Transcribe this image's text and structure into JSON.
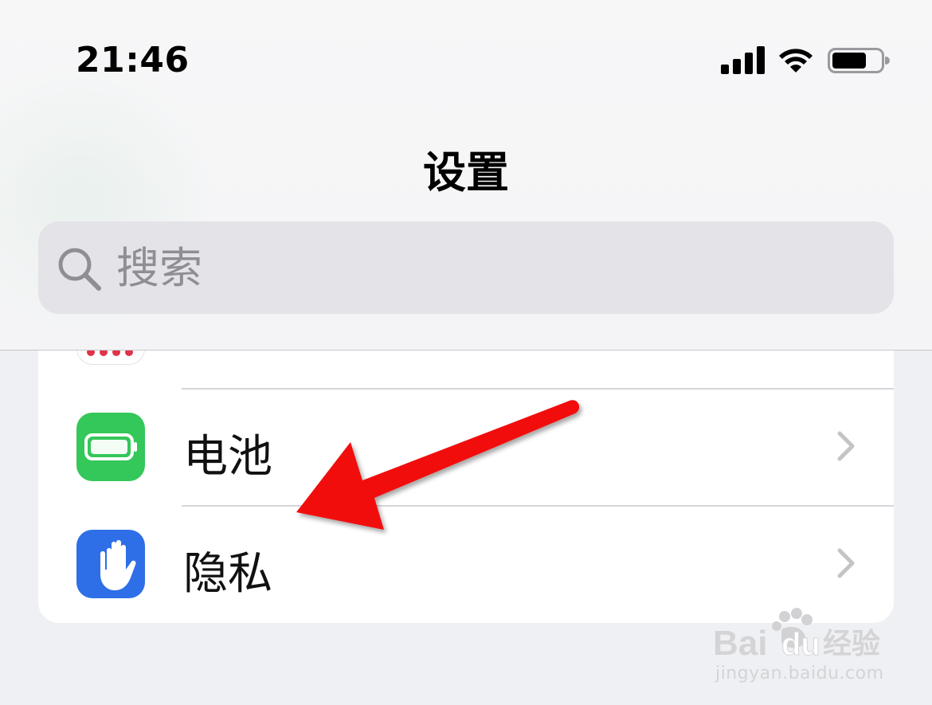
{
  "status_bar": {
    "time": "21:46",
    "icons": [
      "cellular-signal-icon",
      "wifi-icon",
      "battery-icon"
    ]
  },
  "header": {
    "title": "设置"
  },
  "search": {
    "placeholder": "搜索",
    "icon": "search-icon"
  },
  "list": {
    "items": [
      {
        "label": "电池",
        "icon": "battery-app-icon",
        "icon_color": "#34C759"
      },
      {
        "label": "隐私",
        "icon": "privacy-hand-icon",
        "icon_color": "#2E6FE8"
      }
    ]
  },
  "annotation": {
    "type": "red-arrow-icon",
    "color": "#F21010",
    "points_to": "隐私"
  },
  "watermark": {
    "brand": "Baidu经验",
    "domain": "jingyan.baidu.com"
  }
}
